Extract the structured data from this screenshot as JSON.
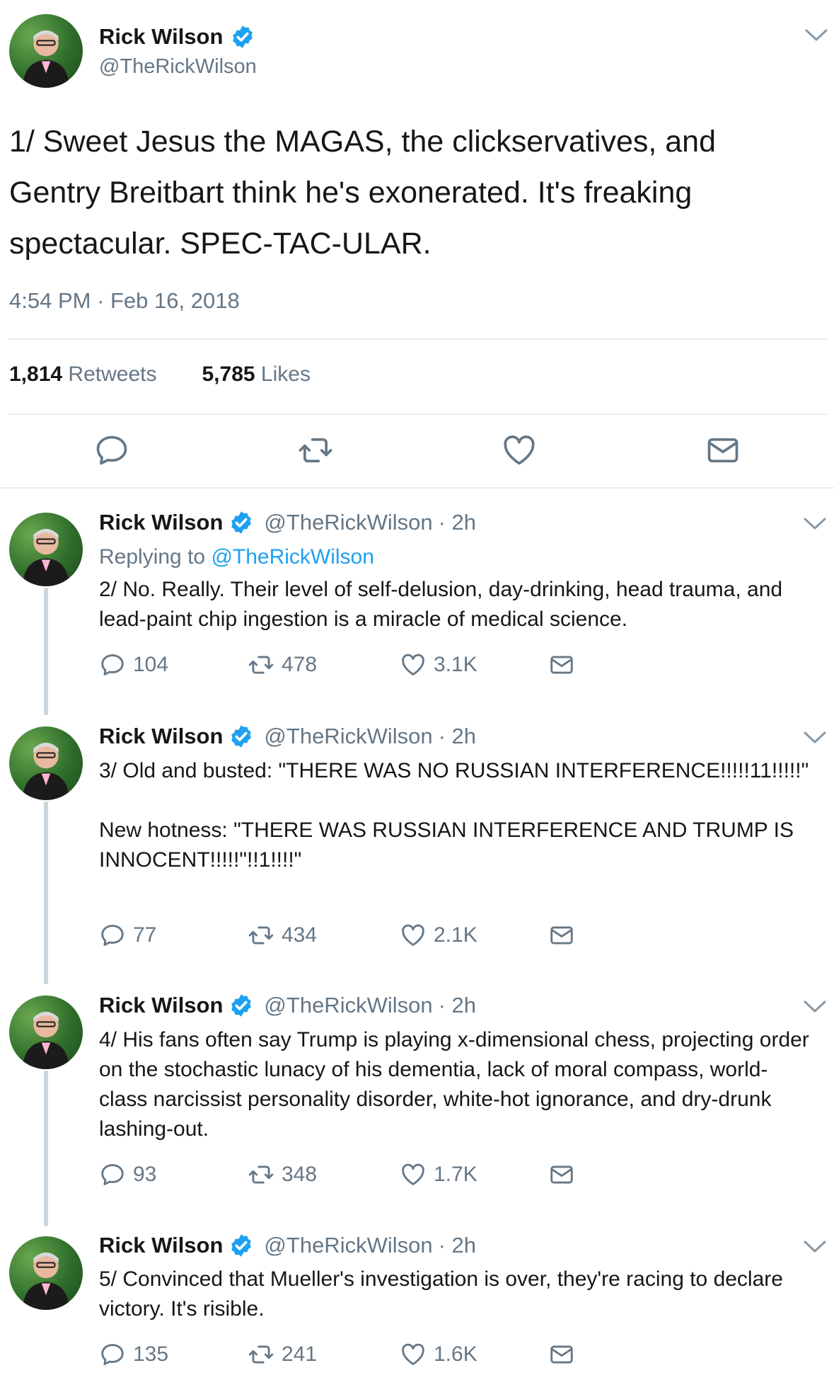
{
  "accent_color": "#1da1f2",
  "main_tweet": {
    "author_name": "Rick Wilson",
    "author_handle": "@TheRickWilson",
    "text": "1/ Sweet Jesus the MAGAS, the clickservatives, and Gentry Breitbart think he's exonerated. It's freaking spectacular. SPEC-TAC-ULAR.",
    "timestamp": "4:54 PM · Feb 16, 2018",
    "retweets_count": "1,814",
    "retweets_label": "Retweets",
    "likes_count": "5,785",
    "likes_label": "Likes",
    "actions": [
      "reply-icon",
      "retweet-icon",
      "like-icon",
      "share-icon"
    ]
  },
  "thread": [
    {
      "author_name": "Rick Wilson",
      "author_handle": "@TheRickWilson",
      "time": "· 2h",
      "replying_label": "Replying to",
      "replying_handle": "@TheRickWilson",
      "text": "2/ No. Really. Their level of self-delusion, day-drinking, head trauma, and lead-paint chip ingestion is a miracle of medical science.",
      "replies": "104",
      "retweets": "478",
      "likes": "3.1K"
    },
    {
      "author_name": "Rick Wilson",
      "author_handle": "@TheRickWilson",
      "time": "· 2h",
      "text": "3/ Old and busted: \"THERE WAS NO RUSSIAN INTERFERENCE!!!!!11!!!!!\"\n\nNew hotness: \"THERE WAS RUSSIAN INTERFERENCE AND TRUMP IS INNOCENT!!!!!\"!!1!!!!\"",
      "replies": "77",
      "retweets": "434",
      "likes": "2.1K"
    },
    {
      "author_name": "Rick Wilson",
      "author_handle": "@TheRickWilson",
      "time": "· 2h",
      "text": "4/ His fans often say Trump is playing x-dimensional chess, projecting order on the stochastic lunacy of his dementia, lack of moral compass, world-class narcissist personality disorder, white-hot ignorance, and dry-drunk lashing-out.",
      "replies": "93",
      "retweets": "348",
      "likes": "1.7K"
    },
    {
      "author_name": "Rick Wilson",
      "author_handle": "@TheRickWilson",
      "time": "· 2h",
      "text": "5/ Convinced that Mueller's investigation is over, they're racing to declare victory. It's risible.",
      "replies": "135",
      "retweets": "241",
      "likes": "1.6K"
    }
  ]
}
